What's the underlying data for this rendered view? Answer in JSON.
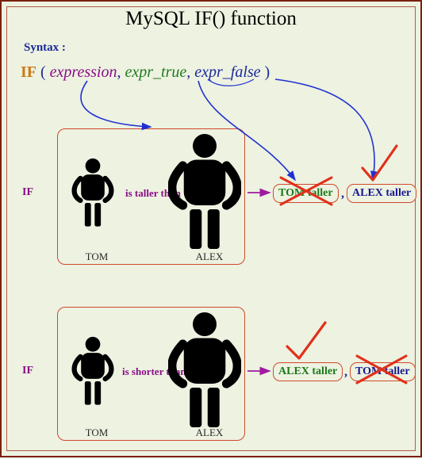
{
  "title": "MySQL IF() function",
  "syntax": {
    "label": "Syntax :",
    "keyword": "IF",
    "open": "( ",
    "expression": "expression",
    "comma": ", ",
    "expr_true": "expr_true",
    "expr_false": "expr_false",
    "close": " )"
  },
  "examples": [
    {
      "if_label": "IF",
      "relation": "is taller than",
      "left_name": "TOM",
      "right_name": "ALEX",
      "result_true": "TOM taller",
      "result_false": "ALEX taller",
      "comma": ",",
      "outcome_mark": [
        "wrong",
        "right"
      ]
    },
    {
      "if_label": "IF",
      "relation": "is shorter than",
      "left_name": "TOM",
      "right_name": "ALEX",
      "result_true": "ALEX taller",
      "result_false": "TOM taller",
      "comma": ",",
      "outcome_mark": [
        "right",
        "wrong"
      ]
    }
  ],
  "figures": {
    "small_scale": 0.85,
    "large_scale": 1.15
  }
}
